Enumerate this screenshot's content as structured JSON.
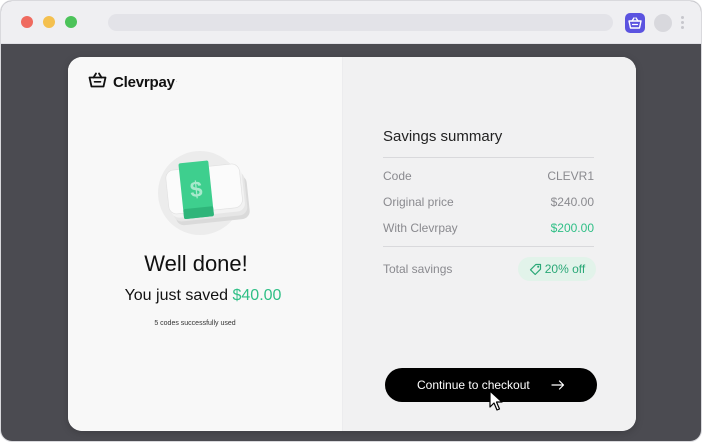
{
  "browser": {
    "colors": {
      "close": "#ef6a5f",
      "minimize": "#f4c04f",
      "maximize": "#4cc35a",
      "extension": "#5b53e0",
      "background": "#4b4b51"
    },
    "extension_icon": "basket-icon",
    "menu_icon": "kebab-menu-icon"
  },
  "brand": {
    "name": "Clevrpay",
    "mark": "·",
    "logo_icon": "basket-icon"
  },
  "left": {
    "heading": "Well done!",
    "saved_prefix": "You just saved",
    "saved_amount": "$40.00",
    "codes_used": "5 codes successfully used",
    "illustration": "cash-stack-illustration"
  },
  "summary": {
    "title": "Savings summary",
    "rows": [
      {
        "label": "Code",
        "value": "CLEVR1"
      },
      {
        "label": "Original price",
        "value": "$240.00"
      },
      {
        "label": "With Clevrpay",
        "value": "$200.00"
      }
    ],
    "total_label": "Total savings",
    "total_badge": "20% off",
    "badge_icon": "tag-icon",
    "accent_color": "#2fbf86"
  },
  "checkout": {
    "label": "Continue to checkout",
    "icon": "arrow-right-icon"
  }
}
